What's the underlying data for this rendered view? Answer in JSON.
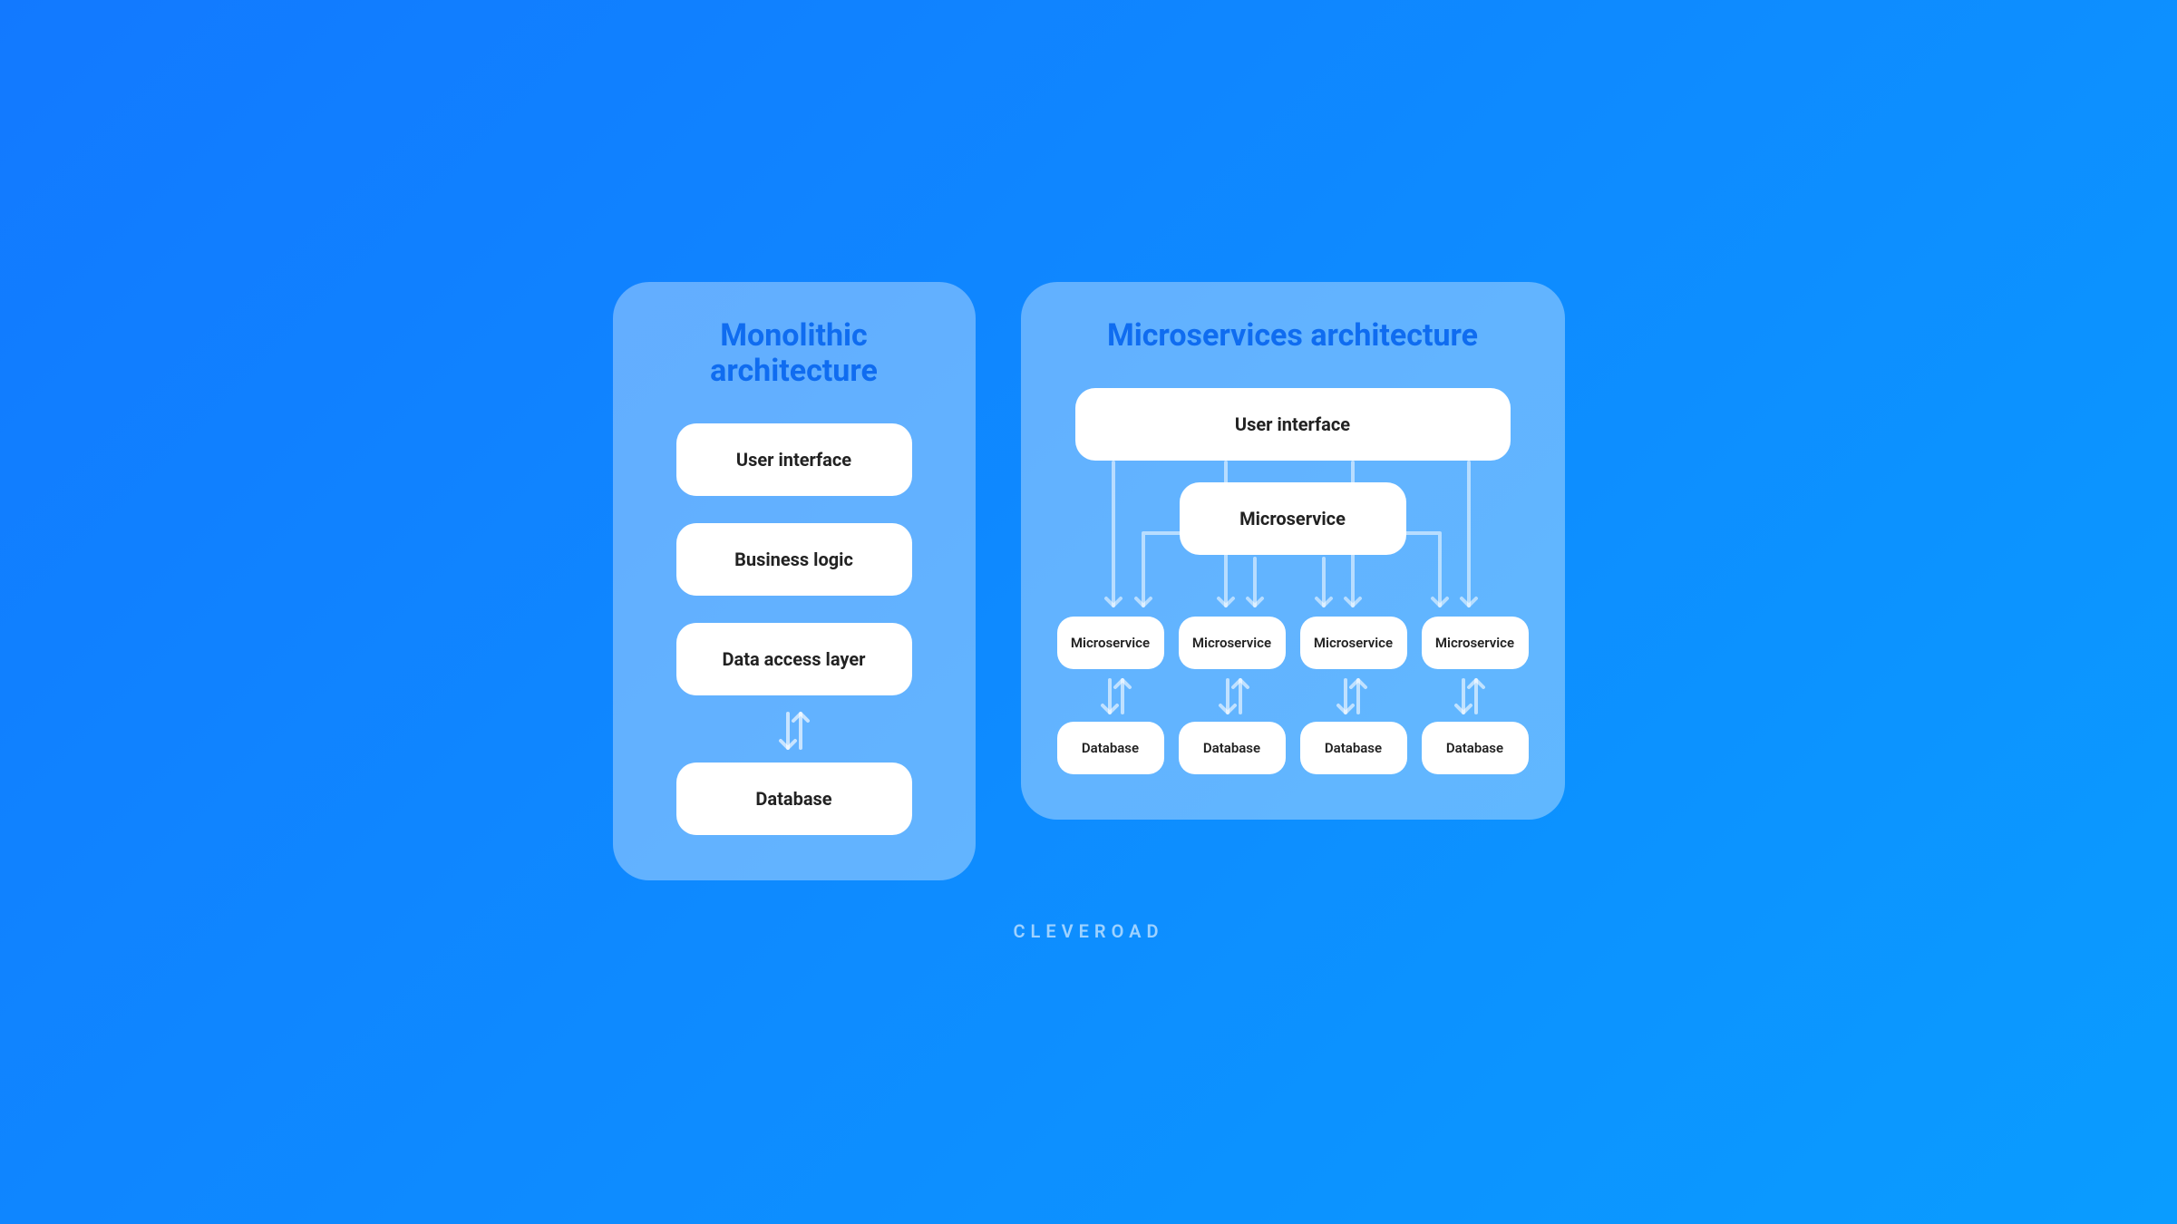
{
  "monolithic": {
    "title": "Monolithic architecture",
    "layers": {
      "ui": "User interface",
      "business": "Business logic",
      "data_access": "Data access layer",
      "database": "Database"
    }
  },
  "microservices": {
    "title": "Microservices architecture",
    "ui": "User interface",
    "mid_microservice": "Microservice",
    "services": [
      "Microservice",
      "Microservice",
      "Microservice",
      "Microservice"
    ],
    "databases": [
      "Database",
      "Database",
      "Database",
      "Database"
    ]
  },
  "brand": "CLEVEROAD"
}
